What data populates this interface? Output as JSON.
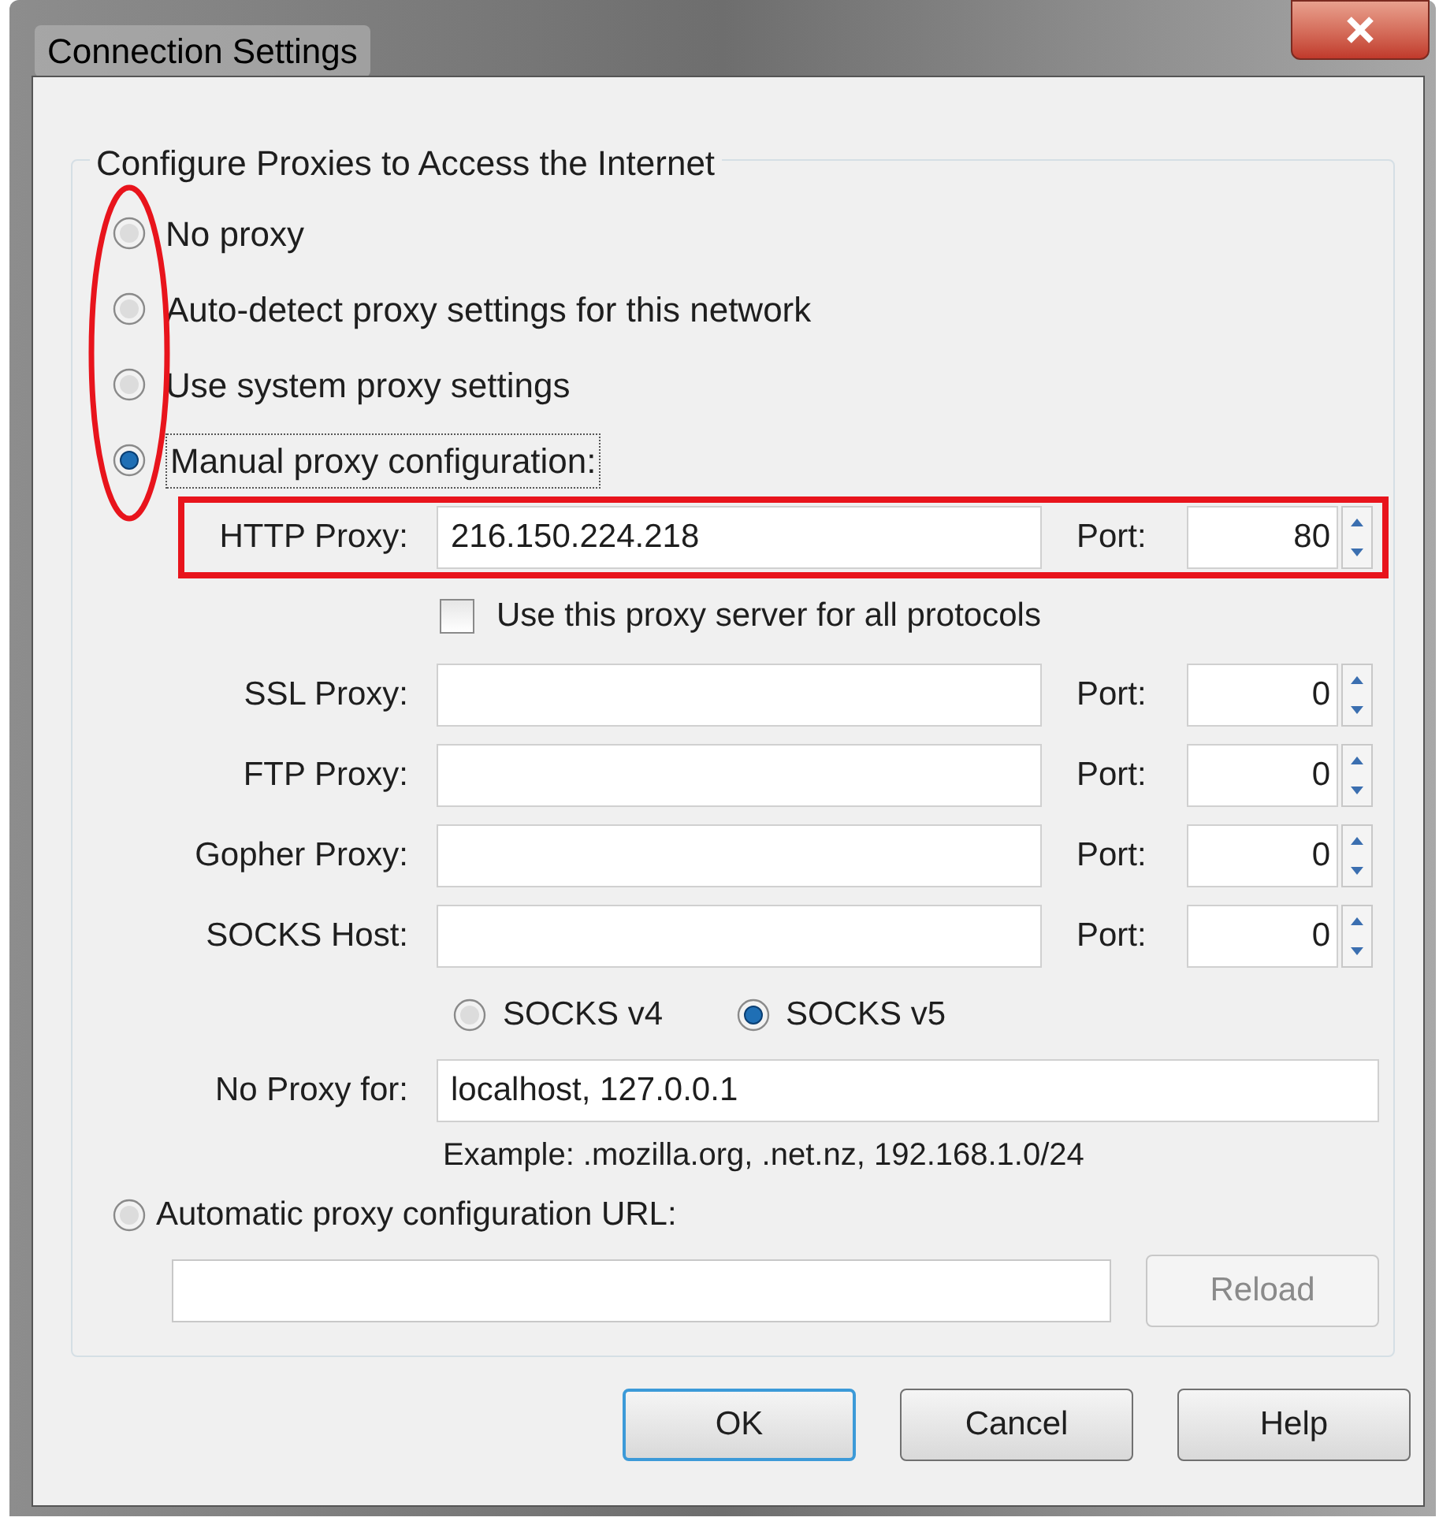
{
  "window": {
    "title": "Connection Settings"
  },
  "group": {
    "title": "Configure Proxies to Access the Internet"
  },
  "modes": [
    {
      "label": "No proxy",
      "selected": false
    },
    {
      "label": "Auto-detect proxy settings for this network",
      "selected": false
    },
    {
      "label": "Use system proxy settings",
      "selected": false
    },
    {
      "label": "Manual proxy configuration:",
      "selected": true
    }
  ],
  "proxies": [
    {
      "label": "HTTP Proxy:",
      "value": "216.150.224.218",
      "port_label": "Port:",
      "port": "80"
    },
    {
      "label": "SSL Proxy:",
      "port_label": "Port:",
      "port": "0"
    },
    {
      "label": "FTP Proxy:",
      "port_label": "Port:",
      "port": "0"
    },
    {
      "label": "Gopher Proxy:",
      "port_label": "Port:",
      "port": "0"
    },
    {
      "label": "SOCKS Host:",
      "port_label": "Port:",
      "port": "0"
    }
  ],
  "share": {
    "label": "Use this proxy server for all protocols",
    "checked": false
  },
  "socks_versions": [
    {
      "label": "SOCKS v4",
      "selected": false
    },
    {
      "label": "SOCKS v5",
      "selected": true
    }
  ],
  "no_proxy": {
    "label": "No Proxy for:",
    "value": "localhost, 127.0.0.1",
    "example": "Example: .mozilla.org, .net.nz, 192.168.1.0/24"
  },
  "auto_config": {
    "label": "Automatic proxy configuration URL:",
    "selected": false,
    "reload": {
      "label": "Reload",
      "disabled": true
    }
  },
  "buttons": [
    {
      "label": "OK",
      "default": true
    },
    {
      "label": "Cancel",
      "default": false
    },
    {
      "label": "Help",
      "default": false
    }
  ]
}
